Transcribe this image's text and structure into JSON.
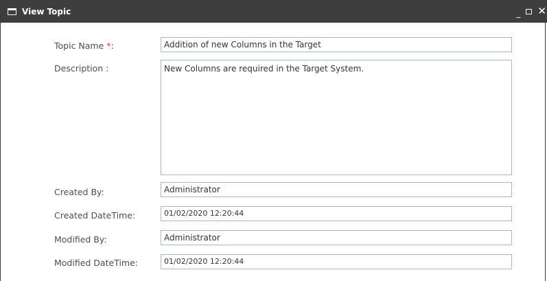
{
  "window": {
    "title": "View Topic",
    "minimize_glyph": "_",
    "close_glyph": "✕"
  },
  "form": {
    "topic_name": {
      "label": "Topic Name ",
      "required_mark": "*",
      "label_suffix": ":",
      "value": "Addition of new Columns in the Target"
    },
    "description": {
      "label": "Description :",
      "value": "New Columns are required in the Target System."
    },
    "created_by": {
      "label": "Created By:",
      "value": "Administrator"
    },
    "created_datetime": {
      "label": "Created DateTime:",
      "value": "01/02/2020 12:20:44"
    },
    "modified_by": {
      "label": "Modified By:",
      "value": "Administrator"
    },
    "modified_datetime": {
      "label": "Modified DateTime:",
      "value": "01/02/2020 12:20:44"
    }
  }
}
